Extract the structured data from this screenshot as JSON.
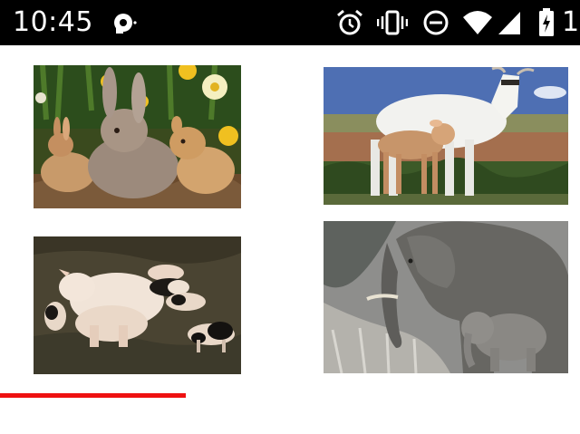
{
  "status_bar": {
    "time": "10:45",
    "battery_text": "1",
    "icons": [
      "notification-cloud-icon",
      "alarm-icon",
      "vibrate-icon",
      "do-not-disturb-icon",
      "wifi-icon",
      "cellular-signal-icon",
      "battery-charging-icon"
    ]
  },
  "images": [
    {
      "name": "rabbits-image",
      "subject": "rabbits"
    },
    {
      "name": "cattle-image",
      "subject": "cow-and-calf"
    },
    {
      "name": "pigs-image",
      "subject": "sow-and-piglets"
    },
    {
      "name": "elephants-image",
      "subject": "elephant-and-calf"
    }
  ],
  "progress": {
    "fraction": 0.32,
    "color": "#ee1111"
  },
  "caption": {
    "text": ""
  }
}
